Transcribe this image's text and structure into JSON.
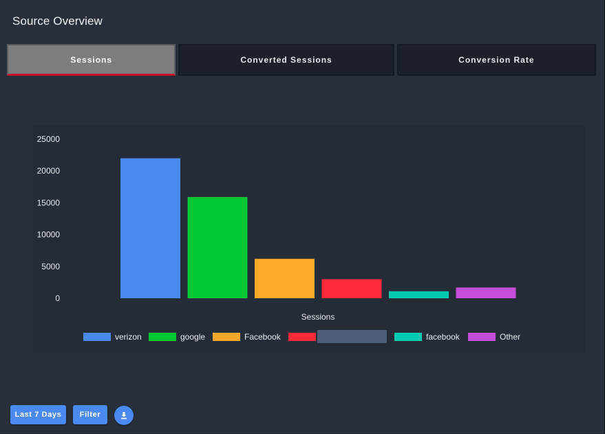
{
  "panel": {
    "title": "Source Overview"
  },
  "tabs": [
    {
      "label": "Sessions",
      "active": true
    },
    {
      "label": "Converted Sessions",
      "active": false
    },
    {
      "label": "Conversion Rate",
      "active": false
    }
  ],
  "chart_data": {
    "type": "bar",
    "xlabel": "Sessions",
    "ylim": [
      0,
      25000
    ],
    "yticks": [
      0,
      5000,
      10000,
      15000,
      20000,
      25000
    ],
    "grid": false,
    "legend_position": "bottom",
    "series": [
      {
        "name": "verizon",
        "value": 22000,
        "color": "#4a8af0"
      },
      {
        "name": "google",
        "value": 15900,
        "color": "#00c832"
      },
      {
        "name": "Facebook",
        "value": 6200,
        "color": "#ffa92b"
      },
      {
        "name": "",
        "value": 3000,
        "color": "#ff2a3a"
      },
      {
        "name": "facebook",
        "value": 1100,
        "color": "#00c9b0"
      },
      {
        "name": "Other",
        "value": 1700,
        "color": "#c44ed8"
      }
    ],
    "redacted_legend_color": "#4d5d78"
  },
  "footer": {
    "days_label": "Last 7 Days",
    "filter_label": "Filter",
    "download_icon": "download-icon"
  }
}
